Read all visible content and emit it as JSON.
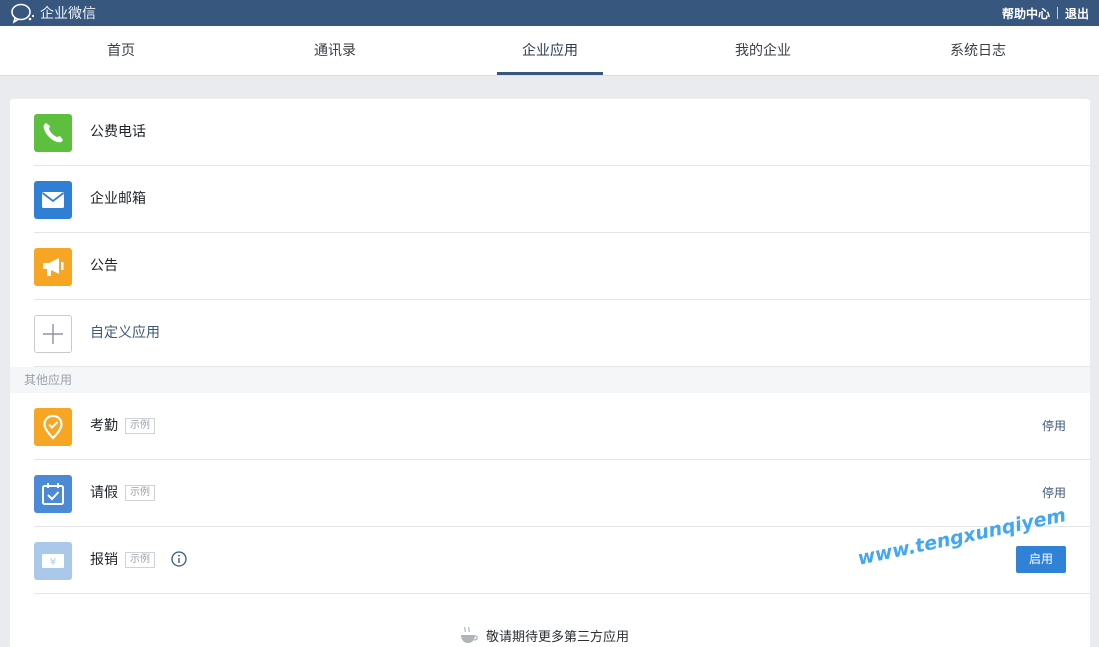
{
  "header": {
    "brand": "企业微信",
    "links": {
      "help": "帮助中心",
      "logout": "退出"
    }
  },
  "nav": {
    "tabs": [
      {
        "label": "首页"
      },
      {
        "label": "通讯录"
      },
      {
        "label": "企业应用",
        "active": true
      },
      {
        "label": "我的企业"
      },
      {
        "label": "系统日志"
      }
    ]
  },
  "apps": {
    "builtin": [
      {
        "name": "公费电话",
        "icon": "phone-icon",
        "color": "#5cbf3e"
      },
      {
        "name": "企业邮箱",
        "icon": "mail-icon",
        "color": "#2f7fd4"
      },
      {
        "name": "公告",
        "icon": "megaphone-icon",
        "color": "#f6a623"
      }
    ],
    "custom": {
      "name": "自定义应用",
      "icon": "plus-icon"
    }
  },
  "other_apps": {
    "title": "其他应用",
    "items": [
      {
        "name": "考勤",
        "tag": "示例",
        "action": "停用",
        "icon": "location-check-icon",
        "color": "#f6a623"
      },
      {
        "name": "请假",
        "tag": "示例",
        "action": "停用",
        "icon": "calendar-check-icon",
        "color": "#4a8ad6"
      },
      {
        "name": "报销",
        "tag": "示例",
        "action": "启用",
        "icon": "yuan-receipt-icon",
        "color": "#a9c8ea",
        "has_info": true
      }
    ]
  },
  "footer": {
    "note": "敬请期待更多第三方应用"
  },
  "watermark": "www.tengxunqiyem"
}
